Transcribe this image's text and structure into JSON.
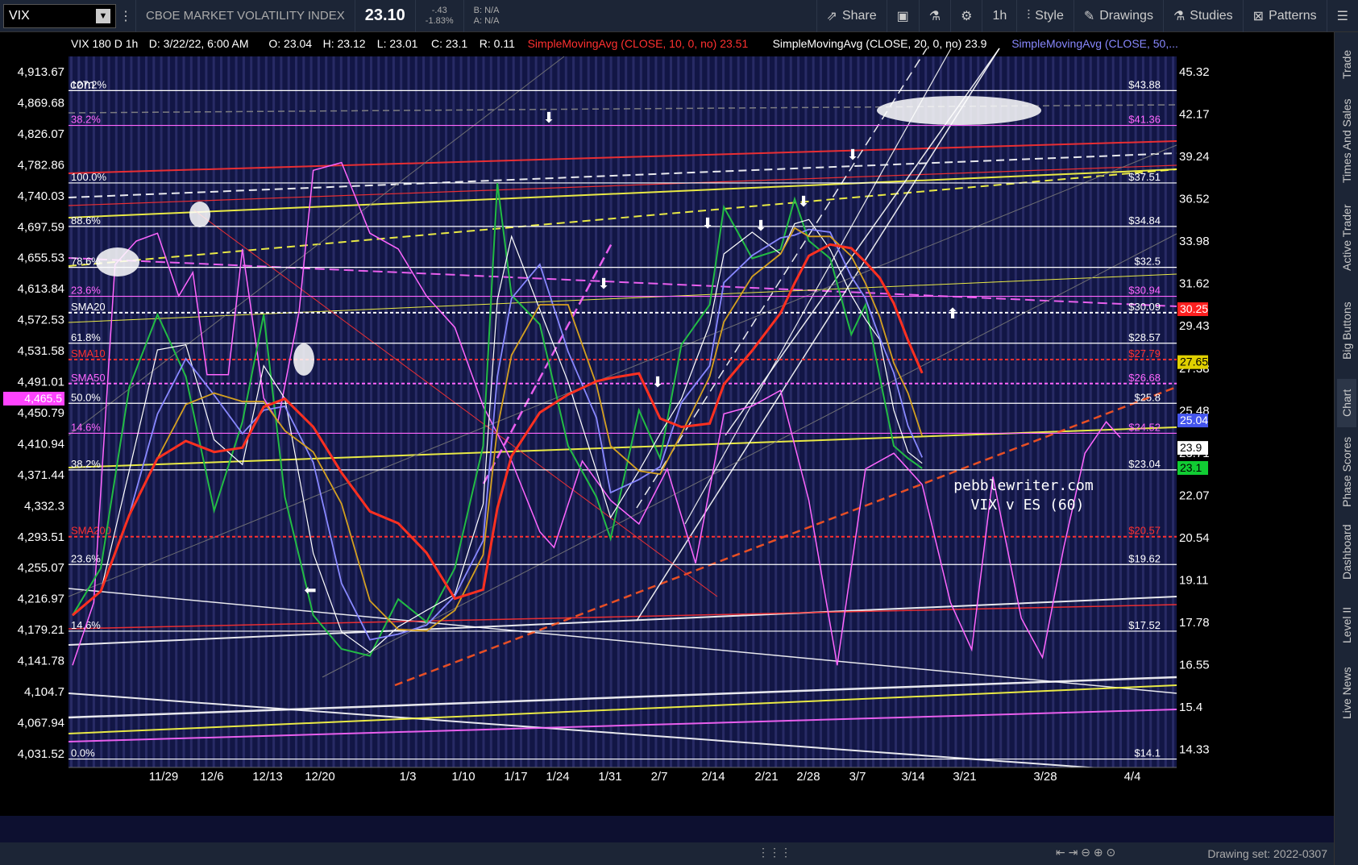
{
  "toolbar": {
    "symbol": "VIX",
    "description": "CBOE MARKET VOLATILITY INDEX",
    "price": "23.10",
    "change": "-.43",
    "change_pct": "-1.83%",
    "bid": "B: N/A",
    "ask": "A: N/A",
    "share": "Share",
    "interval": "1h",
    "style": "Style",
    "drawings": "Drawings",
    "studies": "Studies",
    "patterns": "Patterns"
  },
  "sidebar": [
    "Trade",
    "Times And Sales",
    "Active Trader",
    "Big Buttons",
    "Chart",
    "Phase Scores",
    "Dashboard",
    "Level II",
    "Live News"
  ],
  "bottombar": {
    "drawing_set": "Drawing set: 2022-0307"
  },
  "chart_data": {
    "type": "line",
    "header": {
      "title": "VIX 180 D 1h",
      "date": "D: 3/22/22, 6:00 AM",
      "open": "O: 23.04",
      "high": "H: 23.12",
      "low": "L: 23.01",
      "close": "C: 23.1",
      "range": "R: 0.11",
      "studies": [
        {
          "label": "SimpleMovingAvg (CLOSE, 10, 0, no)",
          "value": "23.51",
          "color": "#ff3030"
        },
        {
          "label": "SimpleMovingAvg (CLOSE, 20, 0, no)",
          "value": "23.9",
          "color": "#ffffff"
        },
        {
          "label": "SimpleMovingAvg (CLOSE, 50,...",
          "value": "",
          "color": "#8888ff"
        }
      ]
    },
    "x_ticks": [
      "11/29",
      "12/6",
      "12/13",
      "12/20",
      "1/3",
      "1/10",
      "1/17",
      "1/24",
      "1/31",
      "2/7",
      "2/14",
      "2/21",
      "2/28",
      "3/7",
      "3/14",
      "3/21",
      "3/28",
      "4/4"
    ],
    "left_axis": {
      "label": "ES",
      "ticks": [
        "4,913.67",
        "4,869.68",
        "4,826.07",
        "4,782.86",
        "4,740.03",
        "4,697.59",
        "4,655.53",
        "4,613.84",
        "4,572.53",
        "4,531.58",
        "4,491.01",
        "4,450.79",
        "4,410.94",
        "4,371.44",
        "4,332.3",
        "4,293.51",
        "4,255.07",
        "4,216.97",
        "4,179.21",
        "4,141.78",
        "4,104.7",
        "4,067.94",
        "4,031.52"
      ],
      "current": "4,465.5"
    },
    "right_axis": {
      "label": "VIX",
      "ticks": [
        "45.32",
        "42.17",
        "39.24",
        "36.52",
        "33.98",
        "31.62",
        "29.43",
        "27.38",
        "25.48",
        "23.71",
        "22.07",
        "20.54",
        "19.11",
        "17.78",
        "16.55",
        "15.4",
        "14.33"
      ],
      "badges": [
        {
          "value": "30.25",
          "bg": "#ff2020",
          "fg": "#ffffff"
        },
        {
          "value": "27.65",
          "bg": "#e0d000",
          "fg": "#000000"
        },
        {
          "value": "25.04",
          "bg": "#4455ee",
          "fg": "#ffffff"
        },
        {
          "value": "23.9",
          "bg": "#ffffff",
          "fg": "#000000"
        },
        {
          "value": "23.1",
          "bg": "#11cc33",
          "fg": "#000000"
        }
      ]
    },
    "levels": [
      {
        "left": "127.2%",
        "right": "$43.88",
        "y": 43.88,
        "color": "#ffffff"
      },
      {
        "left": "38.2%",
        "right": "$41.36",
        "y": 41.36,
        "color": "#ff66ff"
      },
      {
        "left": "100.0%",
        "right": "$37.51",
        "y": 37.51,
        "color": "#ffffff"
      },
      {
        "left": "88.6%",
        "right": "$34.84",
        "y": 34.84,
        "color": "#ffffff"
      },
      {
        "left": "78.6%",
        "right": "$32.5",
        "y": 32.5,
        "color": "#ffffff"
      },
      {
        "left": "23.6%",
        "right": "$30.94",
        "y": 30.94,
        "color": "#ff66ff"
      },
      {
        "left": "SMA20",
        "right": "$30.09",
        "y": 30.09,
        "color": "#ffffff"
      },
      {
        "left": "61.8%",
        "right": "$28.57",
        "y": 28.57,
        "color": "#ffffff"
      },
      {
        "left": "SMA10",
        "right": "$27.79",
        "y": 27.79,
        "color": "#ff3030"
      },
      {
        "left": "SMA50",
        "right": "$26.68",
        "y": 26.68,
        "color": "#ff66ff"
      },
      {
        "left": "50.0%",
        "right": "$25.8",
        "y": 25.8,
        "color": "#ffffff"
      },
      {
        "left": "14.6%",
        "right": "$24.52",
        "y": 24.52,
        "color": "#ff66ff"
      },
      {
        "left": "38.2%",
        "right": "$23.04",
        "y": 23.04,
        "color": "#ffffff"
      },
      {
        "left": "SMA200",
        "right": "$20.57",
        "y": 20.57,
        "color": "#ff3030"
      },
      {
        "left": "23.6%",
        "right": "$19.62",
        "y": 19.62,
        "color": "#ffffff"
      },
      {
        "left": "14.6%",
        "right": "$17.52",
        "y": 17.52,
        "color": "#ffffff"
      },
      {
        "left": "0.0%",
        "right": "$14.1",
        "y": 14.1,
        "color": "#ffffff"
      }
    ],
    "annotations": [
      "pebblewriter.com",
      "VIX v ES (60)",
      "com"
    ],
    "series": [
      {
        "name": "ES",
        "color": "#ff66ff",
        "points": [
          [
            0,
            4150
          ],
          [
            1.5,
            4230
          ],
          [
            3,
            4660
          ],
          [
            4.5,
            4690
          ],
          [
            6,
            4700
          ],
          [
            7.5,
            4620
          ],
          [
            8.5,
            4650
          ],
          [
            9.5,
            4520
          ],
          [
            11,
            4520
          ],
          [
            12,
            4680
          ],
          [
            13.5,
            4490
          ],
          [
            14.5,
            4460
          ],
          [
            16,
            4600
          ],
          [
            17,
            4780
          ],
          [
            19,
            4790
          ],
          [
            21,
            4700
          ],
          [
            23,
            4680
          ],
          [
            25,
            4620
          ],
          [
            27,
            4580
          ],
          [
            29,
            4480
          ],
          [
            31,
            4410
          ],
          [
            33,
            4320
          ],
          [
            34,
            4300
          ],
          [
            36,
            4410
          ],
          [
            38,
            4360
          ],
          [
            40,
            4330
          ],
          [
            42,
            4400
          ],
          [
            44,
            4280
          ],
          [
            46,
            4470
          ],
          [
            48,
            4480
          ],
          [
            50,
            4500
          ],
          [
            52,
            4360
          ],
          [
            54,
            4150
          ],
          [
            56,
            4400
          ],
          [
            58,
            4420
          ],
          [
            60,
            4380
          ],
          [
            62,
            4230
          ],
          [
            63.5,
            4170
          ],
          [
            65,
            4390
          ],
          [
            67,
            4210
          ],
          [
            68.5,
            4160
          ],
          [
            70,
            4300
          ],
          [
            71.5,
            4420
          ],
          [
            73,
            4460
          ],
          [
            74,
            4440
          ]
        ]
      },
      {
        "name": "VIX",
        "color": "#22bb44",
        "points": [
          [
            0,
            18.0
          ],
          [
            2,
            19.5
          ],
          [
            4,
            26.5
          ],
          [
            6,
            30.0
          ],
          [
            8,
            27.0
          ],
          [
            10,
            21.5
          ],
          [
            12,
            25.0
          ],
          [
            13.5,
            30.0
          ],
          [
            15,
            22.0
          ],
          [
            17,
            18.0
          ],
          [
            19,
            17.0
          ],
          [
            21,
            16.8
          ],
          [
            23,
            18.5
          ],
          [
            25,
            17.8
          ],
          [
            27,
            19.5
          ],
          [
            29,
            24.0
          ],
          [
            30,
            37.5
          ],
          [
            31,
            31.0
          ],
          [
            33,
            29.5
          ],
          [
            35,
            24.0
          ],
          [
            37,
            22.0
          ],
          [
            38,
            20.5
          ],
          [
            40,
            25.5
          ],
          [
            41.5,
            23.5
          ],
          [
            43,
            28.5
          ],
          [
            45,
            30.5
          ],
          [
            46,
            36.0
          ],
          [
            48,
            33.0
          ],
          [
            50,
            33.5
          ],
          [
            51,
            36.5
          ],
          [
            52,
            34.0
          ],
          [
            53.5,
            33.0
          ],
          [
            55,
            29.0
          ],
          [
            56,
            30.5
          ],
          [
            57,
            27.0
          ],
          [
            58,
            24.0
          ],
          [
            59,
            23.5
          ],
          [
            60,
            23.1
          ]
        ]
      }
    ]
  }
}
